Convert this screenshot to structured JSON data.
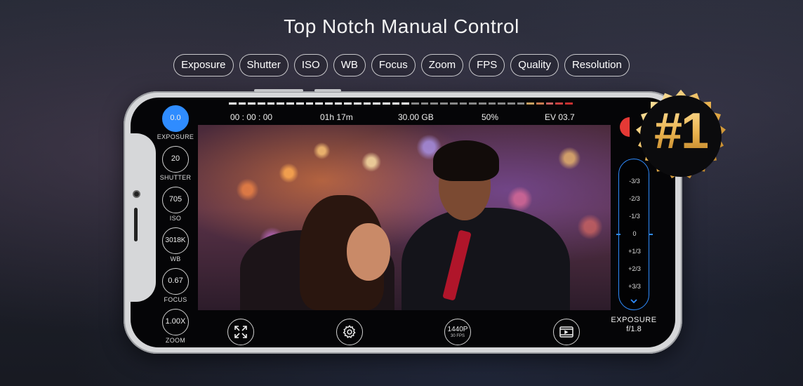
{
  "headline": "Top Notch Manual Control",
  "chips": [
    "Exposure",
    "Shutter",
    "ISO",
    "WB",
    "Focus",
    "Zoom",
    "FPS",
    "Quality",
    "Resolution"
  ],
  "status": {
    "timer": "00 : 00 : 00",
    "remaining": "01h 17m",
    "storage": "30.00 GB",
    "battery": "50%",
    "ev": "EV 03.7"
  },
  "controls": [
    {
      "value": "0.0",
      "label": "EXPOSURE",
      "active": true
    },
    {
      "value": "20",
      "label": "SHUTTER"
    },
    {
      "value": "705",
      "label": "ISO"
    },
    {
      "value": "3018K",
      "label": "WB"
    },
    {
      "value": "0.67",
      "label": "FOCUS"
    },
    {
      "value": "1.00X",
      "label": "ZOOM"
    }
  ],
  "bottom": {
    "resolution": "1440P",
    "fps": "30 FPS"
  },
  "ev_scale": [
    "-3/3",
    "-2/3",
    "-1/3",
    "0",
    "+1/3",
    "+2/3",
    "+3/3"
  ],
  "exposure_panel": {
    "label": "EXPOSURE",
    "value": "f/1.8"
  },
  "badge": "#1",
  "icons": {
    "expand": "expand-icon",
    "settings": "gear-icon",
    "gallery": "video-gallery-icon",
    "chevron": "chevron-down-icon"
  },
  "colors": {
    "accent": "#2f8cff",
    "record": "#e53935",
    "badge_gold": "#e8b04c"
  }
}
